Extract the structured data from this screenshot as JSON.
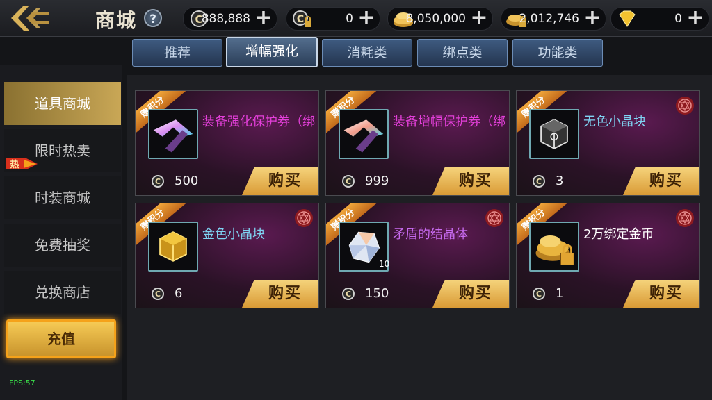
{
  "header": {
    "title": "商城",
    "help": "?",
    "currencies": [
      {
        "icon": "coupon-icon",
        "value": "888,888"
      },
      {
        "icon": "locked-coupon-icon",
        "value": "0"
      },
      {
        "icon": "gold-coins-icon",
        "value": "8,050,000"
      },
      {
        "icon": "locked-gold-coins-icon",
        "value": "2,012,746"
      },
      {
        "icon": "gem-icon",
        "value": "0"
      }
    ]
  },
  "tabs": [
    "推荐",
    "增幅强化",
    "消耗类",
    "绑点类",
    "功能类"
  ],
  "active_tab": "增幅强化",
  "sidebar": {
    "items": [
      "道具商城",
      "限时热卖",
      "时装商城",
      "免费抽奖",
      "兑换商店",
      "充值"
    ],
    "hot_badge": "热",
    "active": "道具商城"
  },
  "fps": "FPS:57",
  "items": [
    {
      "name": "装备强化保护券（绑",
      "price": "500",
      "buy": "购买",
      "ribbon": "赠积分",
      "name_color": "#e23fd8",
      "seal": false,
      "count": ""
    },
    {
      "name": "装备增幅保护券（绑",
      "price": "999",
      "buy": "购买",
      "ribbon": "赠积分",
      "name_color": "#e23fd8",
      "seal": false,
      "count": ""
    },
    {
      "name": "无色小晶块",
      "price": "3",
      "buy": "购买",
      "ribbon": "赠积分",
      "name_color": "#7fd3f2",
      "seal": true,
      "count": ""
    },
    {
      "name": "金色小晶块",
      "price": "6",
      "buy": "购买",
      "ribbon": "赠积分",
      "name_color": "#7fd3f2",
      "seal": true,
      "count": ""
    },
    {
      "name": "矛盾的结晶体",
      "price": "150",
      "buy": "购买",
      "ribbon": "赠积分",
      "name_color": "#c86bf0",
      "seal": true,
      "count": "10"
    },
    {
      "name": "2万绑定金币",
      "price": "1",
      "buy": "购买",
      "ribbon": "赠积分",
      "name_color": "#ffffff",
      "seal": true,
      "count": ""
    }
  ]
}
